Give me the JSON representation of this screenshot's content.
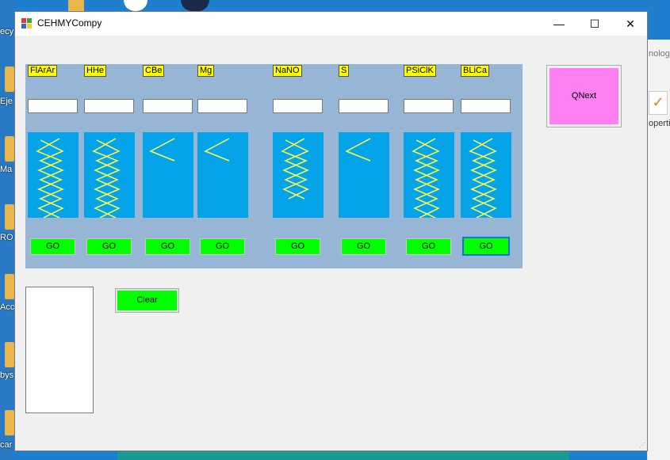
{
  "desktop": {
    "left_labels": [
      "ecy",
      "Eje",
      "Ma",
      "RO",
      "Acc",
      "bys",
      "car"
    ],
    "right_label_top": "nolog",
    "right_label_mid": "operti"
  },
  "window": {
    "title": "CEHMYCompy",
    "minimize": "—",
    "maximize": "☐",
    "close": "✕"
  },
  "columns": [
    {
      "tag": "FlArAr",
      "input": "",
      "go": "GO",
      "zigzags": 3
    },
    {
      "tag": "HHe",
      "input": "",
      "go": "GO",
      "zigzags": 3
    },
    {
      "tag": "CBe",
      "input": "",
      "go": "GO",
      "zigzags": 0
    },
    {
      "tag": "Mg",
      "input": "",
      "go": "GO",
      "zigzags": 0
    },
    {
      "tag": "NaNO",
      "input": "",
      "go": "GO",
      "zigzags": 2
    },
    {
      "tag": "S",
      "input": "",
      "go": "GO",
      "zigzags": 0
    },
    {
      "tag": "PSiClK",
      "input": "",
      "go": "GO",
      "zigzags": 3
    },
    {
      "tag": "BLiCa",
      "input": "",
      "go": "GO",
      "zigzags": 3
    }
  ],
  "qnext": {
    "label": "QNext"
  },
  "clear": {
    "label": "Clear"
  },
  "colors": {
    "panel": "#97b5d5",
    "tag": "#ffff00",
    "pic": "#05a3e8",
    "go": "#00ff00",
    "qnext": "#ff80f2",
    "zigzag": "#ffff4d"
  }
}
